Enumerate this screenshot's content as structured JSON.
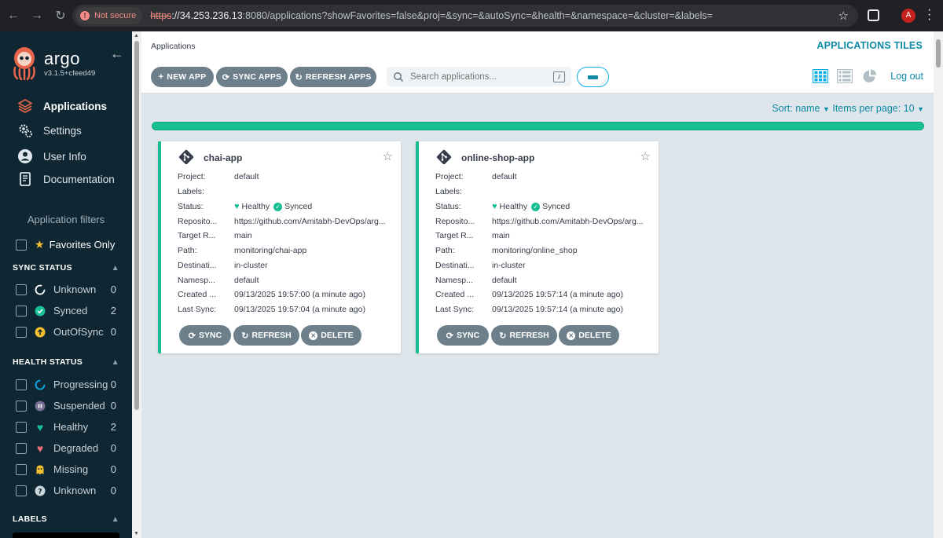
{
  "browser": {
    "security_label": "Not secure",
    "url_scheme": "https",
    "url_host": "://34.253.236.13",
    "url_rest": ":8080/applications?showFavorites=false&proj=&sync=&autoSync=&health=&namespace=&cluster=&labels=",
    "profile_initial": "A"
  },
  "sidebar": {
    "brand": "argo",
    "version": "v3.1.5+cfeed49",
    "nav": [
      {
        "label": "Applications",
        "icon": "layers-icon",
        "active": true
      },
      {
        "label": "Settings",
        "icon": "gears-icon",
        "active": false
      },
      {
        "label": "User Info",
        "icon": "user-circle-icon",
        "active": false
      },
      {
        "label": "Documentation",
        "icon": "book-icon",
        "active": false
      }
    ],
    "filters_title": "Application filters",
    "favorites_label": "Favorites Only",
    "sync_status": {
      "title": "SYNC STATUS",
      "items": [
        {
          "label": "Unknown",
          "count": "0",
          "color": "#ffffff"
        },
        {
          "label": "Synced",
          "count": "2",
          "color": "#18be94"
        },
        {
          "label": "OutOfSync",
          "count": "0",
          "color": "#f4c030"
        }
      ]
    },
    "health_status": {
      "title": "HEALTH STATUS",
      "items": [
        {
          "label": "Progressing",
          "count": "0",
          "color": "#0dadea"
        },
        {
          "label": "Suspended",
          "count": "0",
          "color": "#766f94"
        },
        {
          "label": "Healthy",
          "count": "2",
          "color": "#18be94"
        },
        {
          "label": "Degraded",
          "count": "0",
          "color": "#e96d76"
        },
        {
          "label": "Missing",
          "count": "0",
          "color": "#f4c030"
        },
        {
          "label": "Unknown",
          "count": "0",
          "color": "#ccd6dd"
        }
      ]
    },
    "labels_title": "LABELS"
  },
  "header": {
    "breadcrumb": "Applications",
    "title": "APPLICATIONS TILES",
    "new_app": "NEW APP",
    "sync_apps": "SYNC APPS",
    "refresh_apps": "REFRESH APPS",
    "search_placeholder": "Search applications...",
    "search_shortcut": "/",
    "logout": "Log out"
  },
  "sortbar": {
    "sort": "Sort: name",
    "per_page": "Items per page: 10"
  },
  "field_labels": [
    "Project:",
    "Labels:",
    "Status:",
    "Reposito...",
    "Target R...",
    "Path:",
    "Destinati...",
    "Namesp...",
    "Created ...",
    "Last Sync:"
  ],
  "apps": [
    {
      "name": "chai-app",
      "project": "default",
      "labels": "",
      "health": "Healthy",
      "sync": "Synced",
      "repo": "https://github.com/Amitabh-DevOps/arg...",
      "target": "main",
      "path": "monitoring/chai-app",
      "destination": "in-cluster",
      "namespace": "default",
      "created": "09/13/2025 19:57:00  (a minute ago)",
      "last_sync": "09/13/2025 19:57:04  (a minute ago)"
    },
    {
      "name": "online-shop-app",
      "project": "default",
      "labels": "",
      "health": "Healthy",
      "sync": "Synced",
      "repo": "https://github.com/Amitabh-DevOps/arg...",
      "target": "main",
      "path": "monitoring/online_shop",
      "destination": "in-cluster",
      "namespace": "default",
      "created": "09/13/2025 19:57:14  (a minute ago)",
      "last_sync": "09/13/2025 19:57:14  (a minute ago)"
    }
  ],
  "card_buttons": {
    "sync": "SYNC",
    "refresh": "REFRESH",
    "delete": "DELETE"
  },
  "colors": {
    "accent": "#0d8aa5",
    "healthy": "#18be94",
    "sidebar": "#0f2733",
    "button": "#6d7f8b"
  }
}
